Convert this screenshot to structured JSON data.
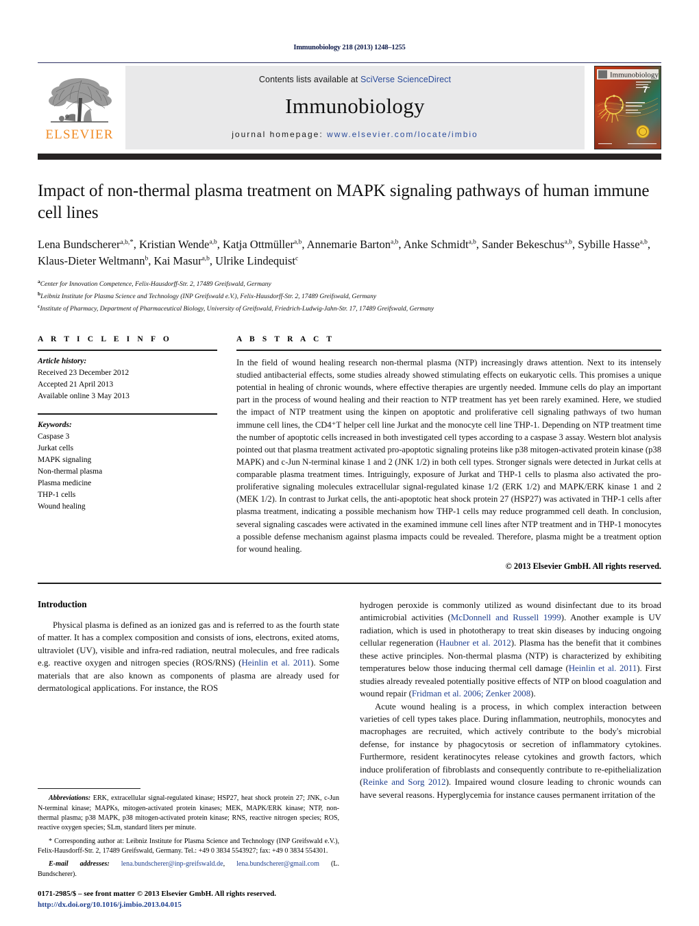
{
  "running_head": "Immunobiology 218 (2013) 1248–1255",
  "header": {
    "contents_prefix": "Contents lists available at ",
    "sciencedirect": "SciVerse ScienceDirect",
    "journal_title": "Immunobiology",
    "homepage_label": "journal homepage:",
    "homepage_url": "www.elsevier.com/locate/imbio",
    "publisher_wordmark": "ELSEVIER",
    "cover_title": "Immunobiology",
    "cover_issue_number": "7",
    "accent_link_color": "#2a4b9b",
    "publisher_color": "#f08a23"
  },
  "article": {
    "title": "Impact of non-thermal plasma treatment on MAPK signaling pathways of human immune cell lines",
    "authors": [
      {
        "name": "Lena Bundscherer",
        "sup": "a,b,*"
      },
      {
        "name": "Kristian Wende",
        "sup": "a,b"
      },
      {
        "name": "Katja Ottmüller",
        "sup": "a,b"
      },
      {
        "name": "Annemarie Barton",
        "sup": "a,b"
      },
      {
        "name": "Anke Schmidt",
        "sup": "a,b"
      },
      {
        "name": "Sander Bekeschus",
        "sup": "a,b"
      },
      {
        "name": "Sybille Hasse",
        "sup": "a,b"
      },
      {
        "name": "Klaus-Dieter Weltmann",
        "sup": "b"
      },
      {
        "name": "Kai Masur",
        "sup": "a,b"
      },
      {
        "name": "Ulrike Lindequist",
        "sup": "c"
      }
    ],
    "affiliations": [
      {
        "mark": "a",
        "text": "Center for Innovation Competence, Felix-Hausdorff-Str. 2, 17489 Greifswald, Germany"
      },
      {
        "mark": "b",
        "text": "Leibniz Institute for Plasma Science and Technology (INP Greifswald e.V.), Felix-Hausdorff-Str. 2, 17489 Greifswald, Germany"
      },
      {
        "mark": "c",
        "text": "Institute of Pharmacy, Department of Pharmaceutical Biology, University of Greifswald, Friedrich-Ludwig-Jahn-Str. 17, 17489 Greifswald, Germany"
      }
    ]
  },
  "article_info": {
    "heading": "A R T I C L E   I N F O",
    "history_label": "Article history:",
    "history": [
      "Received 23 December 2012",
      "Accepted 21 April 2013",
      "Available online 3 May 2013"
    ],
    "keywords_label": "Keywords:",
    "keywords": [
      "Caspase 3",
      "Jurkat cells",
      "MAPK signaling",
      "Non-thermal plasma",
      "Plasma medicine",
      "THP-1 cells",
      "Wound healing"
    ]
  },
  "abstract": {
    "heading": "A B S T R A C T",
    "text": "In the field of wound healing research non-thermal plasma (NTP) increasingly draws attention. Next to its intensely studied antibacterial effects, some studies already showed stimulating effects on eukaryotic cells. This promises a unique potential in healing of chronic wounds, where effective therapies are urgently needed. Immune cells do play an important part in the process of wound healing and their reaction to NTP treatment has yet been rarely examined. Here, we studied the impact of NTP treatment using the kinpen on apoptotic and proliferative cell signaling pathways of two human immune cell lines, the CD4⁺T helper cell line Jurkat and the monocyte cell line THP-1. Depending on NTP treatment time the number of apoptotic cells increased in both investigated cell types according to a caspase 3 assay. Western blot analysis pointed out that plasma treatment activated pro-apoptotic signaling proteins like p38 mitogen-activated protein kinase (p38 MAPK) and c-Jun N-terminal kinase 1 and 2 (JNK 1/2) in both cell types. Stronger signals were detected in Jurkat cells at comparable plasma treatment times. Intriguingly, exposure of Jurkat and THP-1 cells to plasma also activated the pro-proliferative signaling molecules extracellular signal-regulated kinase 1/2 (ERK 1/2) and MAPK/ERK kinase 1 and 2 (MEK 1/2). In contrast to Jurkat cells, the anti-apoptotic heat shock protein 27 (HSP27) was activated in THP-1 cells after plasma treatment, indicating a possible mechanism how THP-1 cells may reduce programmed cell death. In conclusion, several signaling cascades were activated in the examined immune cell lines after NTP treatment and in THP-1 monocytes a possible defense mechanism against plasma impacts could be revealed. Therefore, plasma might be a treatment option for wound healing.",
    "copyright": "© 2013 Elsevier GmbH. All rights reserved."
  },
  "introduction": {
    "heading": "Introduction",
    "para_1_a": "Physical plasma is defined as an ionized gas and is referred to as the fourth state of matter. It has a complex composition and consists of ions, electrons, exited atoms, ultraviolet (UV), visible and infra-red radiation, neutral molecules, and free radicals e.g. reactive oxygen and nitrogen species (ROS/RNS) (",
    "para_1_ref": "Heinlin et al. 2011",
    "para_1_b": "). Some materials that are also known as components of plasma are already used for dermatological applications. For instance, the ROS",
    "right_1_a": "hydrogen peroxide is commonly utilized as wound disinfectant due to its broad antimicrobial activities (",
    "right_1_ref1": "McDonnell and Russell 1999",
    "right_1_b": "). Another example is UV radiation, which is used in phototherapy to treat skin diseases by inducing ongoing cellular regeneration (",
    "right_1_ref2": "Haubner et al. 2012",
    "right_1_c": "). Plasma has the benefit that it combines these active principles. Non-thermal plasma (NTP) is characterized by exhibiting temperatures below those inducing thermal cell damage (",
    "right_1_ref3": "Heinlin et al. 2011",
    "right_1_d": "). First studies already revealed potentially positive effects of NTP on blood coagulation and wound repair (",
    "right_1_ref4": "Fridman et al. 2006; Zenker 2008",
    "right_1_e": ").",
    "right_2_a": "Acute wound healing is a process, in which complex interaction between varieties of cell types takes place. During inflammation, neutrophils, monocytes and macrophages are recruited, which actively contribute to the body's microbial defense, for instance by phagocytosis or secretion of inflammatory cytokines. Furthermore, resident keratinocytes release cytokines and growth factors, which induce proliferation of fibroblasts and consequently contribute to re-epithelialization (",
    "right_2_ref": "Reinke and Sorg 2012",
    "right_2_b": "). Impaired wound closure leading to chronic wounds can have several reasons. Hyperglycemia for instance causes permanent irritation of the"
  },
  "footnotes": {
    "abbreviations_label": "Abbreviations:",
    "abbreviations_text": " ERK, extracellular signal-regulated kinase; HSP27, heat shock protein 27; JNK, c-Jun N-terminal kinase; MAPKs, mitogen-activated protein kinases; MEK, MAPK/ERK kinase; NTP, non-thermal plasma; p38 MAPK, p38 mitogen-activated protein kinase; RNS, reactive nitrogen species; ROS, reactive oxygen species; SLm, standard liters per minute.",
    "corresponding_text": "* Corresponding author at: Leibniz Institute for Plasma Science and Technology (INP Greifswald e.V.), Felix-Hausdorff-Str. 2, 17489 Greifswald, Germany. Tel.: +49 0 3834 5543927; fax: +49 0 3834 554301.",
    "email_label": "E-mail addresses:",
    "email_1": "lena.bundscherer@inp-greifswald.de",
    "email_2": "lena.bundscherer@gmail.com",
    "email_suffix": " (L. Bundscherer).",
    "issn_line": "0171-2985/$ – see front matter © 2013 Elsevier GmbH. All rights reserved.",
    "doi_line": "http://dx.doi.org/10.1016/j.imbio.2013.04.015"
  }
}
